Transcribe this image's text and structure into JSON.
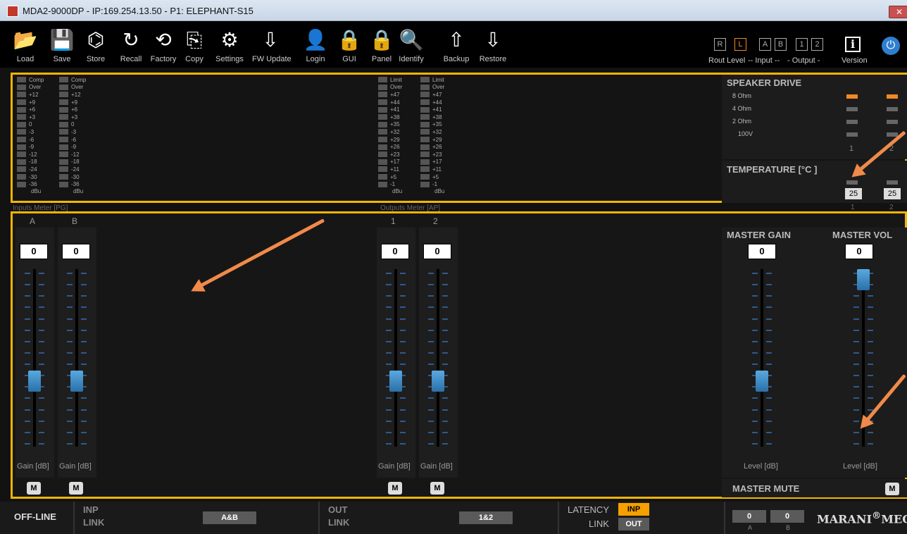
{
  "window": {
    "title": "MDA2-9000DP - IP:169.254.13.50 - P1: ELEPHANT-S15",
    "close": "✕"
  },
  "toolbar": {
    "tools": [
      {
        "icon": "folder-open-icon",
        "glyph": "📂",
        "label": "Load"
      },
      {
        "icon": "save-icon",
        "glyph": "💾",
        "label": "Save"
      },
      {
        "icon": "chip-icon",
        "glyph": "⌬",
        "label": "Store"
      },
      {
        "icon": "recall-icon",
        "glyph": "↻",
        "label": "Recall"
      },
      {
        "icon": "factory-icon",
        "glyph": "⟲",
        "label": "Factory"
      },
      {
        "icon": "copy-icon",
        "glyph": "⎘",
        "label": "Copy"
      },
      {
        "icon": "gear-icon",
        "glyph": "⚙",
        "label": "Settings"
      },
      {
        "icon": "firmware-update-icon",
        "glyph": "⇩",
        "label": "FW Update"
      },
      {
        "icon": "login-icon",
        "glyph": "👤",
        "label": "Login"
      },
      {
        "icon": "lock-icon",
        "glyph": "🔒",
        "label": "GUI"
      },
      {
        "icon": "panel-lock-icon",
        "glyph": "🔒",
        "label": "Panel"
      },
      {
        "icon": "identify-icon",
        "glyph": "🔍",
        "label": "Identify"
      },
      {
        "icon": "backup-icon",
        "glyph": "⇧",
        "label": "Backup"
      },
      {
        "icon": "restore-icon",
        "glyph": "⇩",
        "label": "Restore"
      }
    ],
    "routing": {
      "boxes": [
        "R",
        "L",
        "A",
        "B",
        "1",
        "2"
      ],
      "labels": [
        "Rout",
        "Level",
        "-- Input --",
        "- Output -"
      ],
      "version_label": "Version",
      "info_glyph": "i",
      "power_glyph": "⏻"
    }
  },
  "meters": {
    "input_scale_top": [
      "Comp",
      "Over"
    ],
    "input_scale": [
      "+12",
      "+9",
      "+6",
      "+3",
      "0",
      "-3",
      "-6",
      "-9",
      "-12",
      "-18",
      "-24",
      "-30",
      "-36"
    ],
    "output_scale_top": [
      "Limit",
      "Over"
    ],
    "output_scale": [
      "+47",
      "+44",
      "+41",
      "+38",
      "+35",
      "+32",
      "+29",
      "+26",
      "+23",
      "+17",
      "+11",
      "+5",
      "-1"
    ],
    "unit": "dBu",
    "inputs_label": "Inputs Meter [PG]",
    "outputs_label": "Outputs Meter [AP]"
  },
  "speaker_drive": {
    "title": "SPEAKER DRIVE",
    "rows": [
      "8 Ohm",
      "4 Ohm",
      "2 Ohm",
      "100V"
    ],
    "channels": [
      "1",
      "2"
    ],
    "active_row": "8 Ohm"
  },
  "temperature": {
    "title": "TEMPERATURE [°C ]",
    "values": [
      "25",
      "25"
    ],
    "channels": [
      "1",
      "2"
    ]
  },
  "inputs": [
    {
      "name": "A",
      "value": "0",
      "gain_label": "Gain [dB]",
      "mute": "M",
      "level_pct": 35
    },
    {
      "name": "B",
      "value": "0",
      "gain_label": "Gain [dB]",
      "mute": "M",
      "level_pct": 35
    }
  ],
  "outputs": [
    {
      "name": "1",
      "value": "0",
      "gain_label": "Gain [dB]",
      "mute": "M",
      "level_pct": 35
    },
    {
      "name": "2",
      "value": "0",
      "gain_label": "Gain [dB]",
      "mute": "M",
      "level_pct": 35
    }
  ],
  "master": {
    "gain_title": "MASTER GAIN",
    "gain_value": "0",
    "gain_label": "Level [dB]",
    "gain_level_pct": 35,
    "vol_title": "MASTER VOL",
    "vol_value": "0",
    "vol_label": "Level [dB]",
    "vol_level_pct": 100,
    "mute_title": "MASTER MUTE",
    "mute": "M"
  },
  "bottom": {
    "status": "OFF-LINE",
    "inp_link": [
      "INP",
      "LINK"
    ],
    "inp_link_value": "A&B",
    "out_link": [
      "OUT",
      "LINK"
    ],
    "out_link_value": "1&2",
    "latency_link": [
      "LATENCY",
      "LINK"
    ],
    "latency_inp": "INP",
    "latency_out": "OUT",
    "delay_a": "0",
    "delay_b": "0",
    "delay_labels": [
      "A",
      "B"
    ],
    "brand": "MARANI",
    "brand_mark": "®",
    "brand_suffix": "MEQ"
  },
  "colors": {
    "accent": "#f5b500",
    "orange": "#f08a24",
    "fader": "#3a8cc8"
  }
}
